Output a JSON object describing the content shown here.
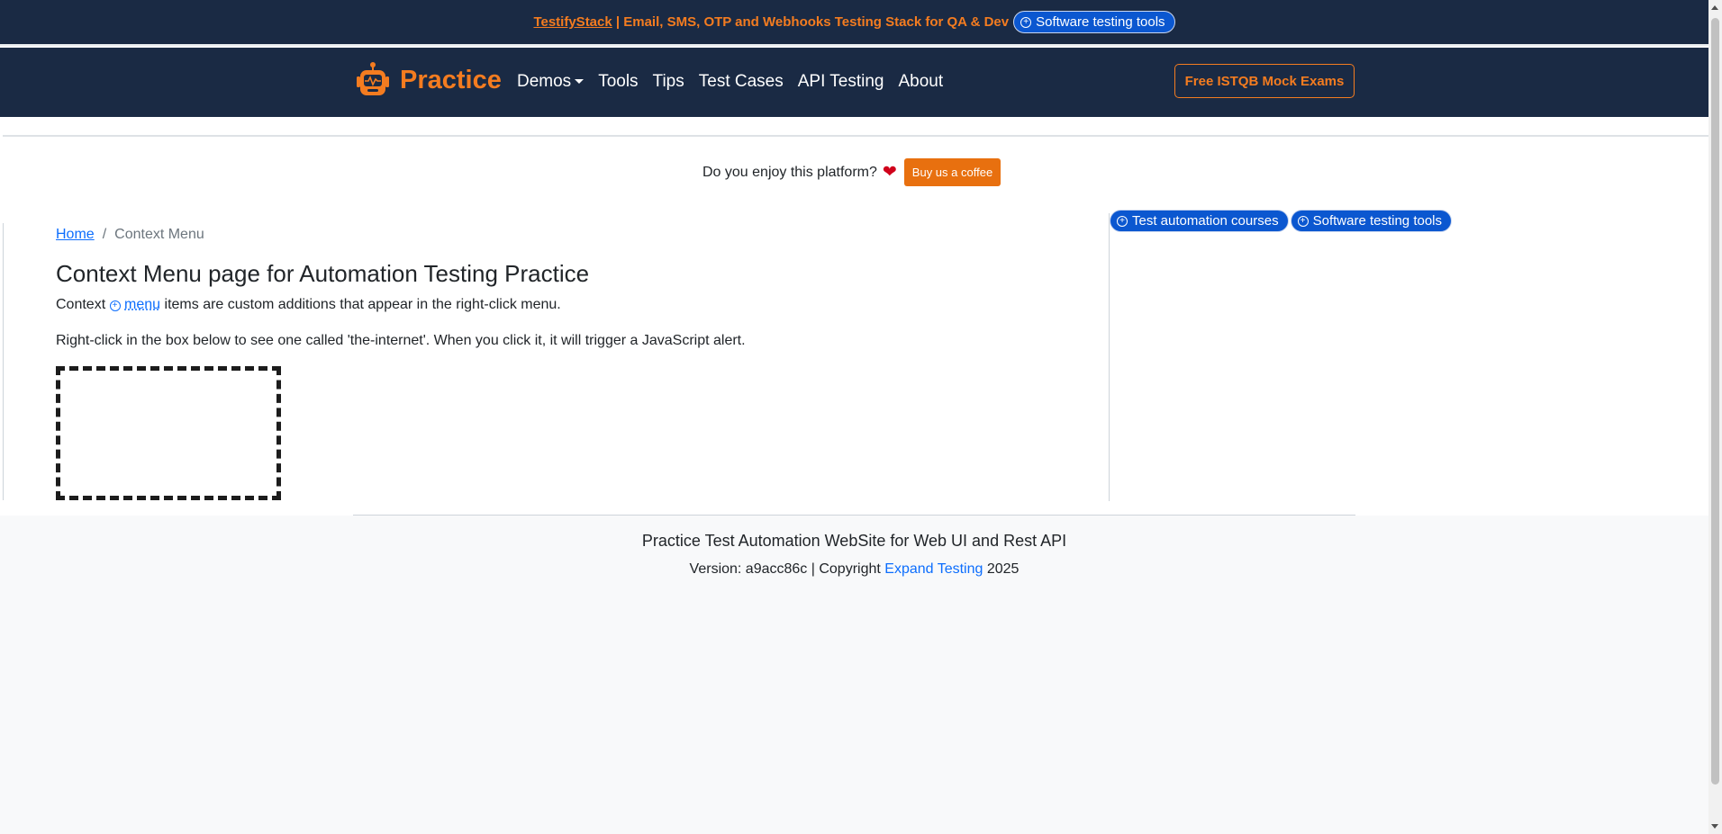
{
  "topbar": {
    "brand_link": "TestifyStack",
    "promo_text": " | Email, SMS, OTP and Webhooks Testing Stack for QA & Dev",
    "pill_label": "Software testing tools",
    "pill_icon": "plus-circle-icon"
  },
  "navbar": {
    "brand": "Practice",
    "logo_icon": "robot-icon",
    "links": [
      "Demos",
      "Tools",
      "Tips",
      "Test Cases",
      "API Testing",
      "About"
    ],
    "cta": "Free ISTQB Mock Exams"
  },
  "support": {
    "question": "Do you enjoy this platform?",
    "heart_icon": "heart-icon",
    "button": "Buy us a coffee"
  },
  "breadcrumb": {
    "home": "Home",
    "separator": "/",
    "current": "Context Menu"
  },
  "main": {
    "title": "Context Menu page for Automation Testing Practice",
    "p1_before": "Context ",
    "p1_link": "menu",
    "p1_after": " items are custom additions that appear in the right-click menu.",
    "p2": "Right-click in the box below to see one called 'the-internet'. When you click it, it will trigger a JavaScript alert."
  },
  "sidebar": {
    "pills": [
      "Test automation courses",
      "Software testing tools"
    ]
  },
  "footer": {
    "title": "Practice Test Automation WebSite for Web UI and Rest API",
    "version_prefix": "Version: a9acc86c | Copyright ",
    "company": "Expand Testing",
    "year": " 2025"
  },
  "colors": {
    "navy": "#1a2a44",
    "orange": "#f47c20",
    "blue": "#0d6efd",
    "pill_blue": "#0b57d0"
  }
}
